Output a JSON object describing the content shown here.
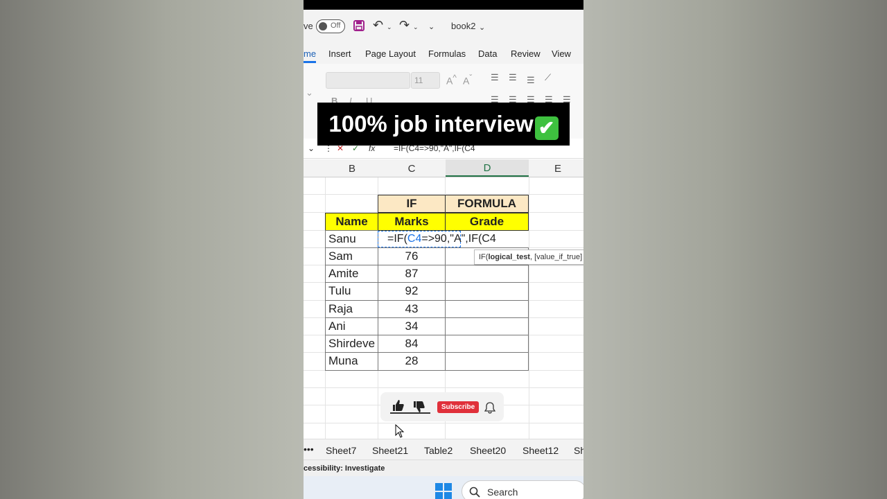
{
  "qat": {
    "autosave_label": "ve",
    "toggle_label": "Off",
    "workbook_name": "book2"
  },
  "tabs": [
    "me",
    "Insert",
    "Page Layout",
    "Formulas",
    "Data",
    "Review",
    "View"
  ],
  "ribbon": {
    "font_size": "11"
  },
  "formula_bar": {
    "content": "=IF(C4=>90,\"A\",IF(C4"
  },
  "overlay_banner": {
    "text": "100% job interview",
    "emoji": "✔"
  },
  "columns": [
    "B",
    "C",
    "D",
    "E"
  ],
  "table": {
    "header_row1": {
      "c": "IF",
      "d": "FORMULA"
    },
    "header_row2": {
      "b": "Name",
      "c": "Marks",
      "d": "Grade"
    },
    "rows": [
      {
        "name": "Sanu",
        "marks": ""
      },
      {
        "name": "Sam",
        "marks": "76"
      },
      {
        "name": "Amite",
        "marks": "87"
      },
      {
        "name": "Tulu",
        "marks": "92"
      },
      {
        "name": "Raja",
        "marks": "43"
      },
      {
        "name": "Ani",
        "marks": "34"
      },
      {
        "name": "Shirdeve",
        "marks": "84"
      },
      {
        "name": "Muna",
        "marks": "28"
      }
    ]
  },
  "editing_cell": {
    "prefix": "=IF(",
    "ref1": "C4",
    "middle": "=>90,\"A\",IF(C4"
  },
  "tooltip": {
    "func": "IF(",
    "arg1": "logical_test",
    "rest": ", [value_if_true]"
  },
  "youtube": {
    "subscribe": "Subscribe"
  },
  "sheets": [
    "Sheet7",
    "Sheet21",
    "Table2",
    "Sheet20",
    "Sheet12",
    "Sh"
  ],
  "status": {
    "text": "cessibility: Investigate"
  },
  "taskbar": {
    "search": "Search"
  },
  "colors": {
    "header_yellow": "#ffff00",
    "header_peach": "#fce8c4",
    "excel_green": "#217346",
    "subscribe_red": "#e0303a"
  }
}
